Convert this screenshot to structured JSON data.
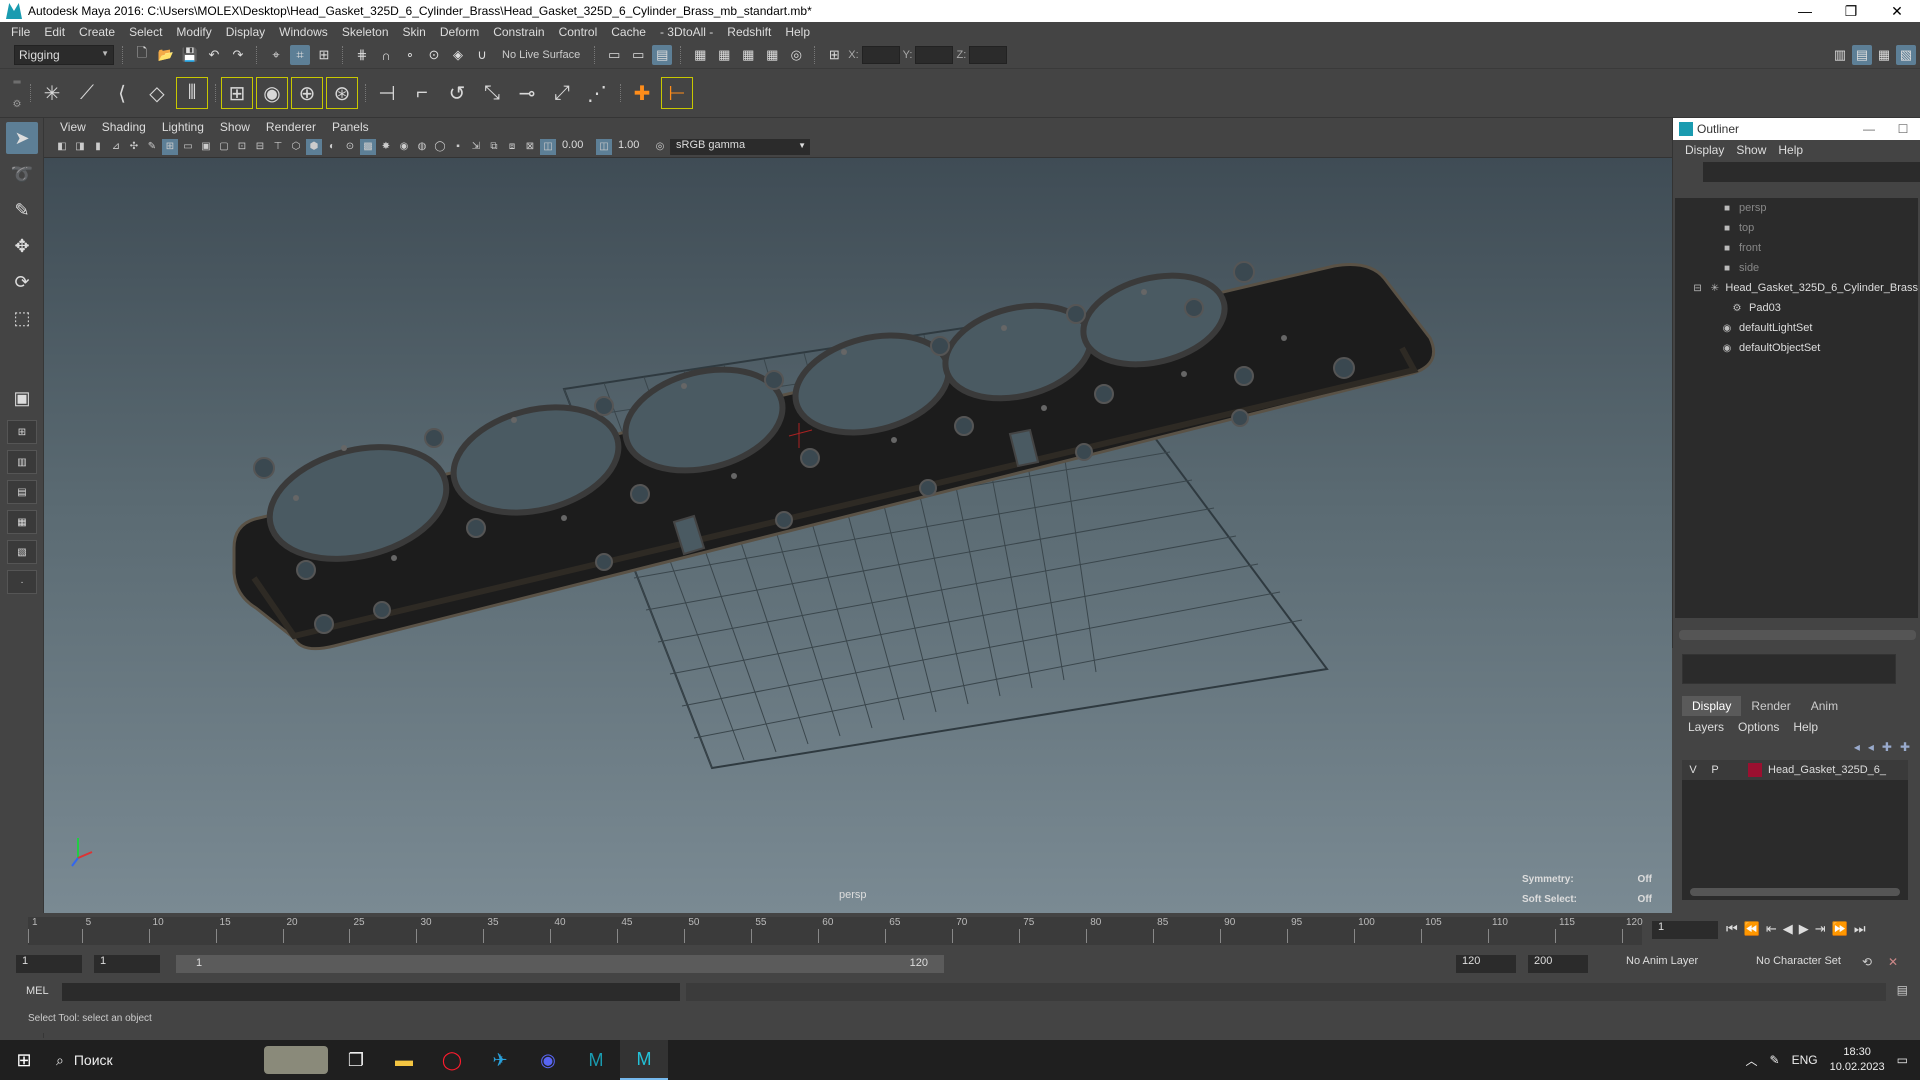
{
  "window": {
    "title": "Autodesk Maya 2016: C:\\Users\\MOLEX\\Desktop\\Head_Gasket_325D_6_Cylinder_Brass\\Head_Gasket_325D_6_Cylinder_Brass_mb_standart.mb*",
    "minimize": "—",
    "restore": "❐",
    "close": "✕"
  },
  "menubar": [
    "File",
    "Edit",
    "Create",
    "Select",
    "Modify",
    "Display",
    "Windows",
    "Skeleton",
    "Skin",
    "Deform",
    "Constrain",
    "Control",
    "Cache",
    "- 3DtoAll -",
    "Redshift",
    "Help"
  ],
  "statusline": {
    "mode": "Rigging",
    "live_surface": "No Live Surface",
    "x_label": "X:",
    "y_label": "Y:",
    "z_label": "Z:"
  },
  "viewport": {
    "menu": [
      "View",
      "Shading",
      "Lighting",
      "Show",
      "Renderer",
      "Panels"
    ],
    "exposure": "0.00",
    "gamma_value": "1.00",
    "color_space": "sRGB gamma",
    "camera_label": "persp",
    "symmetry_label": "Symmetry:",
    "symmetry_value": "Off",
    "soft_select_label": "Soft Select:",
    "soft_select_value": "Off"
  },
  "outliner": {
    "title": "Outliner",
    "menu": [
      "Display",
      "Show",
      "Help"
    ],
    "items": [
      {
        "label": "persp",
        "type": "camera"
      },
      {
        "label": "top",
        "type": "camera"
      },
      {
        "label": "front",
        "type": "camera"
      },
      {
        "label": "side",
        "type": "camera"
      },
      {
        "label": "Head_Gasket_325D_6_Cylinder_Brass",
        "type": "group"
      },
      {
        "label": "Pad03",
        "type": "mesh"
      },
      {
        "label": "defaultLightSet",
        "type": "set"
      },
      {
        "label": "defaultObjectSet",
        "type": "set"
      }
    ]
  },
  "channel_box": {
    "tabs": [
      "Display",
      "Render",
      "Anim"
    ],
    "menu": [
      "Layers",
      "Options",
      "Help"
    ],
    "layer": {
      "v": "V",
      "p": "P",
      "name": "Head_Gasket_325D_6_",
      "color": "#9a1030"
    }
  },
  "timeline": {
    "ticks": [
      "1",
      "5",
      "10",
      "15",
      "20",
      "25",
      "30",
      "35",
      "40",
      "45",
      "50",
      "55",
      "60",
      "65",
      "70",
      "75",
      "80",
      "85",
      "90",
      "95",
      "100",
      "105",
      "110",
      "115",
      "120"
    ],
    "current_frame": "1"
  },
  "range": {
    "start": "1",
    "playback_start": "1",
    "slider_start": "1",
    "slider_end": "120",
    "playback_end": "120",
    "end": "200",
    "anim_layer": "No Anim Layer",
    "character_set": "No Character Set"
  },
  "command_line": {
    "label": "MEL"
  },
  "help_line": "Select Tool: select an object",
  "taskbar": {
    "search": "Поиск",
    "lang": "ENG",
    "time": "18:30",
    "date": "10.02.2023"
  }
}
